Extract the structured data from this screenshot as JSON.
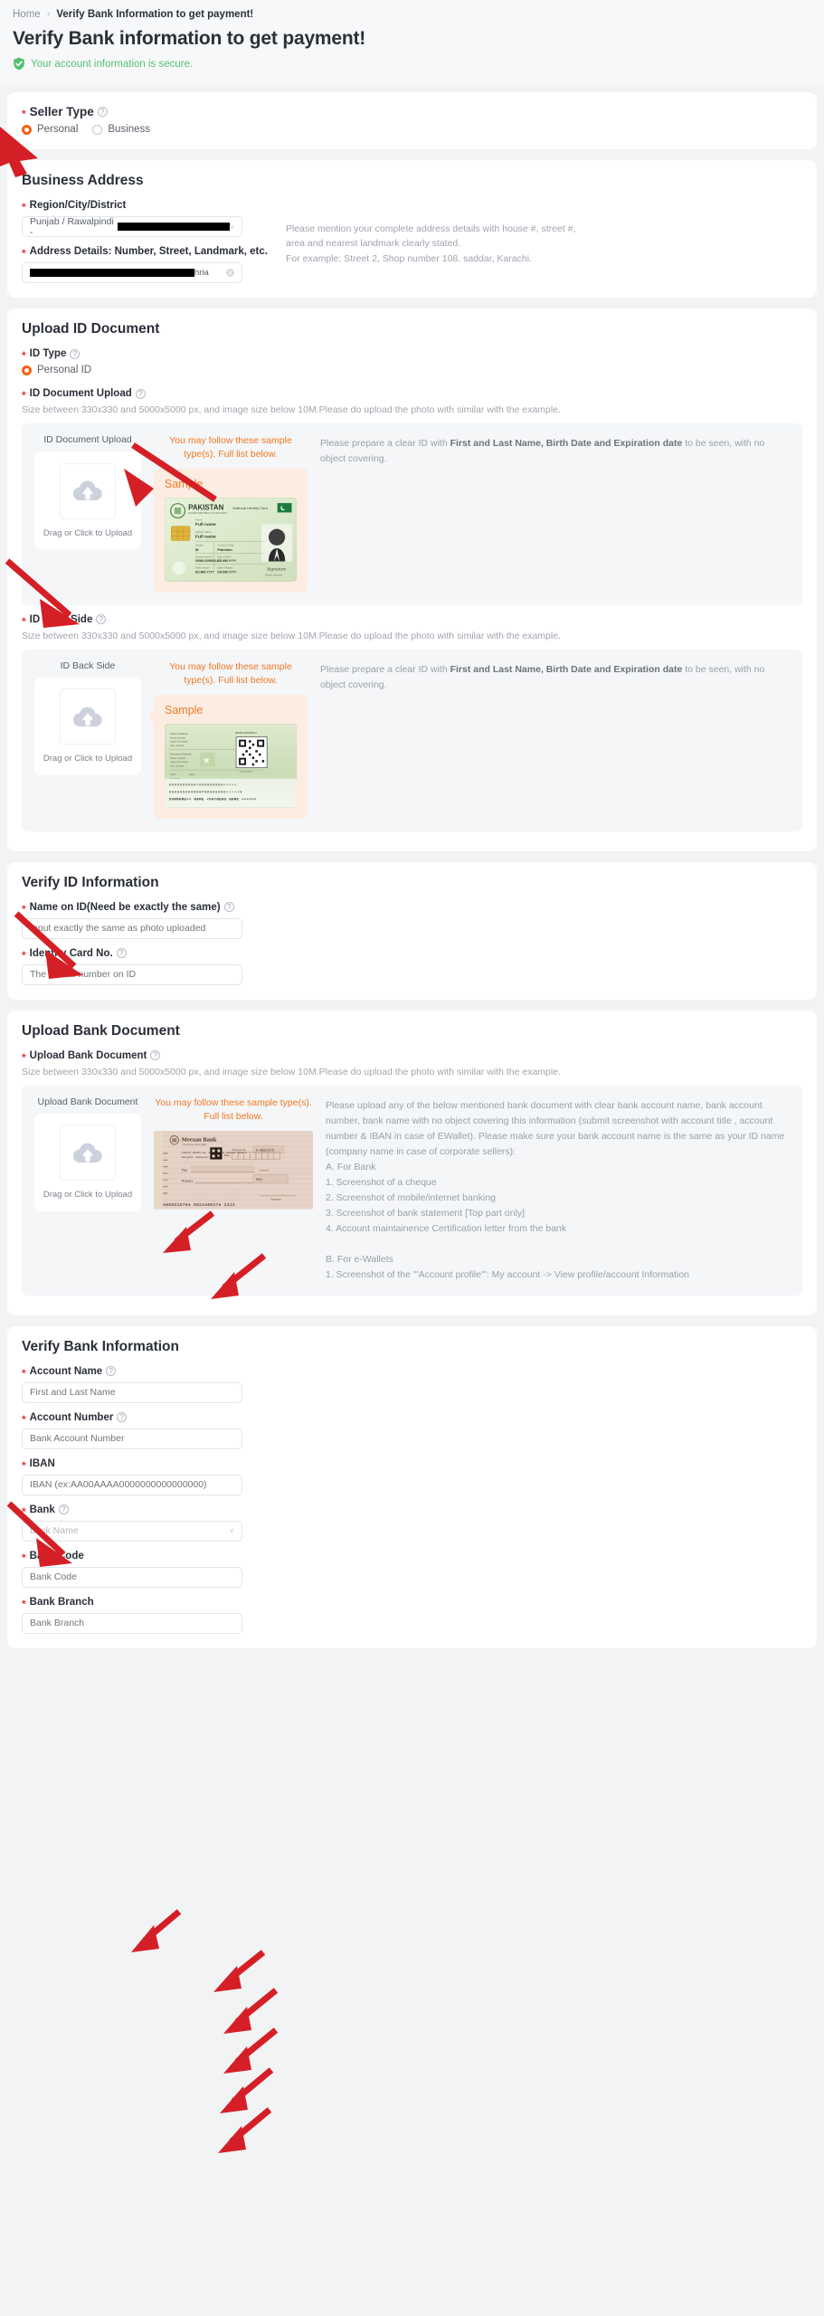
{
  "breadcrumb": {
    "home": "Home",
    "separator": "›",
    "current": "Verify Bank Information to get payment!"
  },
  "page": {
    "title": "Verify Bank information to get payment!",
    "secure_note": "Your account information is secure.",
    "accent_orange": "#f4620f",
    "accent_green": "#56c271",
    "accent_red": "#e6343c",
    "sample_orange": "#ef7a28"
  },
  "seller_type": {
    "label": "Seller Type",
    "options": [
      {
        "label": "Personal",
        "selected": true
      },
      {
        "label": "Business",
        "selected": false
      }
    ]
  },
  "business_address": {
    "title": "Business Address",
    "region_label": "Region/City/District",
    "region_value": "Punjab / Rawalpindi -",
    "address_label": "Address Details: Number, Street, Landmark, etc.",
    "address_value_tail": "hria",
    "hint": "Please mention your complete address details with house #, street #, area and nearest landmark clearly stated.\nFor example: Street 2, Shop number 108, saddar, Karachi."
  },
  "upload_id": {
    "title": "Upload ID Document",
    "id_type_label": "ID Type",
    "id_type_option": "Personal ID",
    "doc_upload_label": "ID Document Upload",
    "size_hint": "Size between 330x330 and 5000x5000 px, and image size below 10M.Please do upload the photo with similar with the example.",
    "front": {
      "col_title": "ID Document Upload",
      "drop_text": "Drag or Click to Upload",
      "sample_head": "You may follow these sample type(s). Full list below.",
      "sample_word": "Sample",
      "desc_pre": "Please prepare a clear ID with ",
      "desc_bold": "First and Last Name, Birth Date and Expiration date",
      "desc_post": " to be seen, with no object covering."
    },
    "back_label": "ID Back Side",
    "back_size_hint": "Size between 330x330 and 5000x5000 px, and image size below 10M.Please do upload the photo with similar with the example.",
    "back": {
      "col_title": "ID Back Side",
      "drop_text": "Drag or Click to Upload",
      "sample_head": "You may follow these sample type(s). Full list below.",
      "sample_word": "Sample",
      "desc_pre": "Please prepare a clear ID with ",
      "desc_bold": "First and Last Name, Birth Date and Expiration date",
      "desc_post": " to be seen, with no object covering."
    },
    "sample_card_front": {
      "country": "PAKISTAN",
      "card_type": "National Identity Card",
      "fields": [
        {
          "label": "Name",
          "value": "Full name"
        },
        {
          "label": "Father's Name",
          "value": "Full name"
        },
        {
          "label": "Gender",
          "value": "M"
        },
        {
          "label": "Country of Stay",
          "value": "Pakistan"
        },
        {
          "label": "Identity Number",
          "value": "00000-0000000-0"
        },
        {
          "label": "Date of Birth",
          "value": "DD.MM.YYYY"
        },
        {
          "label": "Date of Issue",
          "value": "DD.MM.YYYY"
        },
        {
          "label": "Date of Expiry",
          "value": "DD.MM.YYYY"
        }
      ],
      "signature": "Signature",
      "signature_caption": "Holder's Signature"
    },
    "sample_card_back": {
      "present_address": "Present Address: house number, name of a street, City, Country",
      "permanent_address": "Permanent Address: house number, name of a street, City, Country",
      "id_number": "00000-0000000-0",
      "mrz_line1": "K000000000<000000000<<<<<",
      "mrz_line2": "000000000000PAK000000<<<<<0",
      "mrz_line3": "SURNAME<<NAME<FATHERS NAME<<<<<<"
    }
  },
  "verify_id": {
    "title": "Verify ID Information",
    "name_label": "Name on ID(Need be exactly the same)",
    "name_placeholder": "Input exactly the same as photo uploaded",
    "name_value": "",
    "idcard_label": "Identity Card No.",
    "idcard_placeholder": "The official number on ID",
    "idcard_value": ""
  },
  "upload_bank": {
    "title": "Upload Bank Document",
    "field_label": "Upload Bank Document",
    "size_hint": "Size between 330x330 and 5000x5000 px, and image size below 10M.Please do upload the photo with similar with the example.",
    "col_title": "Upload Bank Document",
    "drop_text": "Drag or Click to Upload",
    "sample_head": "You may follow these sample type(s). Full list below.",
    "description": "Please upload any of the below mentioned bank document with clear bank account name, bank account number, bank name with no object covering this information (submit screenshot with account title , account number & IBAN in case of EWallet). Please make sure your bank account name is the same as your ID name (company name in case of corporate sellers):\nA. For Bank\n1. Screenshot of a cheque\n2. Screenshot of mobile/internet banking\n3. Screenshot of bank statement [Top part only]\n4. Account maintainence Certification letter from the bank\n\nB. For e-Wallets\n1. Screenshot of the '\"Account profile'\": My account -> View profile/account Information",
    "cheque_sample": {
      "bank_name": "Meezan Bank",
      "bank_tagline": "The Premier Islamic Bank",
      "branch_line1": "(9933) BLOCK-18, GULISTAN-E-JAUHAR BRANCH",
      "branch_line2": "Karachi- Pakistan",
      "cheque_no_label": "Cheque No.",
      "cheque_no": "A-86831576",
      "date_label": "Date",
      "pay_label": "Pay",
      "rupees_label": "Rupees",
      "bearer_label": "or bearer",
      "currency": "PKR",
      "signature_label": "Signature"
    }
  },
  "verify_bank": {
    "title": "Verify Bank Information",
    "fields": [
      {
        "label": "Account Name",
        "placeholder": "First and Last Name",
        "value": "",
        "has_help": true,
        "type": "text"
      },
      {
        "label": "Account Number",
        "placeholder": "Bank Account Number",
        "value": "",
        "has_help": true,
        "type": "text"
      },
      {
        "label": "IBAN",
        "placeholder": "IBAN (ex:AA00AAAA0000000000000000)",
        "value": "",
        "has_help": false,
        "type": "text"
      },
      {
        "label": "Bank",
        "placeholder": "bank Name",
        "value": "",
        "has_help": true,
        "type": "select"
      },
      {
        "label": "Bank Code",
        "placeholder": "Bank Code",
        "value": "",
        "has_help": false,
        "type": "text"
      },
      {
        "label": "Bank Branch",
        "placeholder": "Bank Branch",
        "value": "",
        "has_help": false,
        "type": "text"
      }
    ]
  },
  "annotations": {
    "arrow_color": "#d51f26",
    "count": 13
  }
}
